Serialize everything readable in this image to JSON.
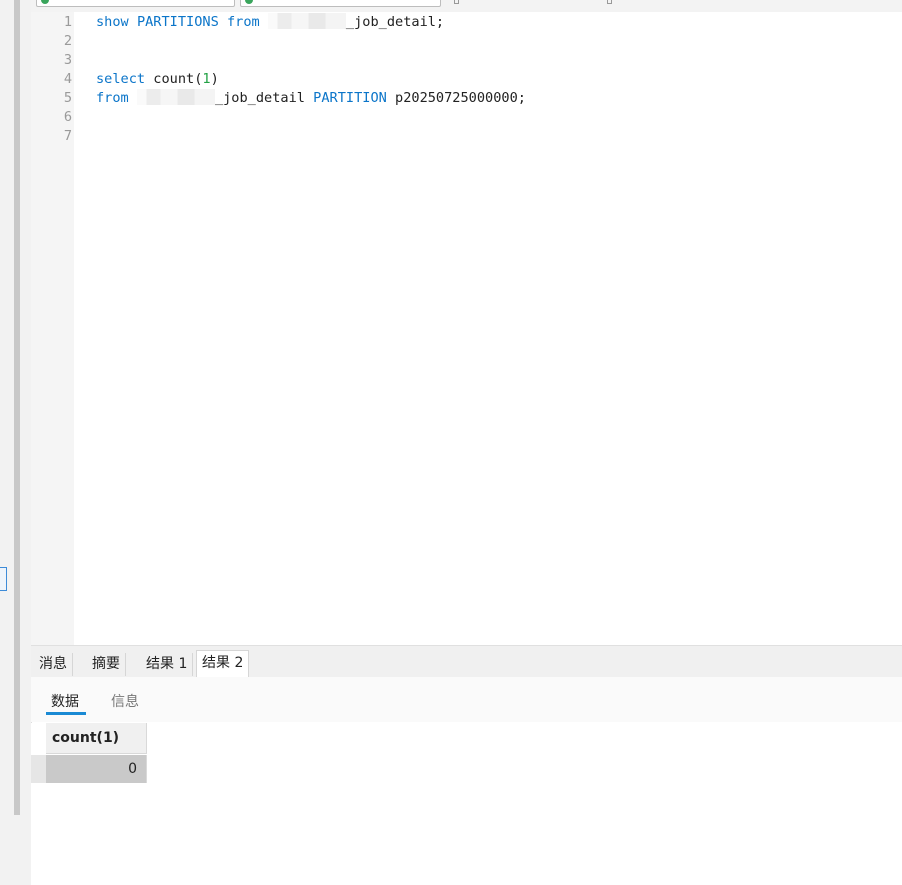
{
  "editor": {
    "lines": [
      {
        "num": "1",
        "parts": [
          {
            "t": "show",
            "k": "kw"
          },
          {
            "t": " ",
            "k": ""
          },
          {
            "t": "PARTITIONS",
            "k": "kw"
          },
          {
            "t": " ",
            "k": ""
          },
          {
            "t": "from",
            "k": "kw"
          },
          {
            "t": " ",
            "k": ""
          },
          {
            "t": "",
            "k": "blur"
          },
          {
            "t": "_job_detail;",
            "k": ""
          }
        ]
      },
      {
        "num": "2",
        "parts": []
      },
      {
        "num": "3",
        "parts": []
      },
      {
        "num": "4",
        "parts": [
          {
            "t": "select",
            "k": "kw"
          },
          {
            "t": " count(",
            "k": ""
          },
          {
            "t": "1",
            "k": "num"
          },
          {
            "t": ")",
            "k": ""
          }
        ]
      },
      {
        "num": "5",
        "parts": [
          {
            "t": "from",
            "k": "kw"
          },
          {
            "t": " ",
            "k": ""
          },
          {
            "t": "",
            "k": "blur"
          },
          {
            "t": "_job_detail ",
            "k": ""
          },
          {
            "t": "PARTITION",
            "k": "kw"
          },
          {
            "t": " p20250725000000;",
            "k": ""
          }
        ]
      },
      {
        "num": "6",
        "parts": []
      },
      {
        "num": "7",
        "parts": []
      }
    ]
  },
  "result_tabs": [
    {
      "label": "消息",
      "active": false
    },
    {
      "label": "摘要",
      "active": false
    },
    {
      "label": "结果 1",
      "active": false
    },
    {
      "label": "结果 2",
      "active": true
    }
  ],
  "sub_tabs": [
    {
      "label": "数据",
      "active": true
    },
    {
      "label": "信息",
      "active": false
    }
  ],
  "grid": {
    "columns": [
      "count(1)"
    ],
    "rows": [
      [
        "0"
      ]
    ]
  },
  "colors": {
    "keyword": "#0b75c9",
    "number": "#22a144",
    "accent": "#1a8ad4"
  }
}
